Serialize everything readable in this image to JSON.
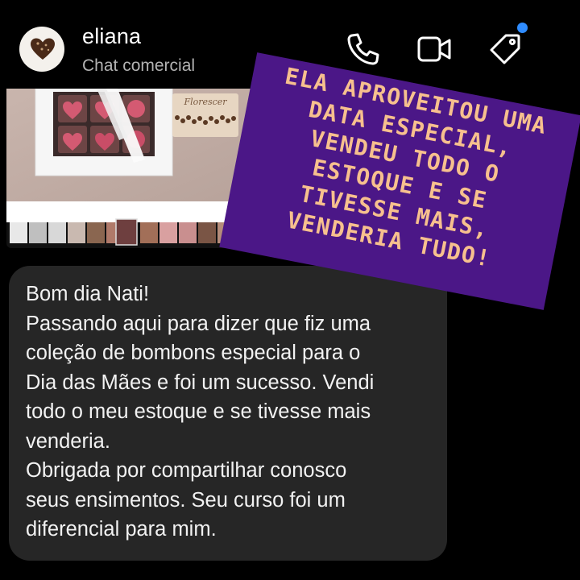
{
  "header": {
    "contact_name": "eliana",
    "contact_subtitle": "Chat comercial",
    "icons": [
      "phone-icon",
      "video-icon",
      "tag-icon"
    ],
    "notification_dot_color": "#2f8cff"
  },
  "shared_photo": {
    "card_text": "Florescer"
  },
  "message": {
    "lines": [
      "Bom dia Nati!",
      "Passando aqui para dizer que fiz uma",
      "coleção de bombons especial para o",
      "Dia das Mães e foi um sucesso. Vendi",
      "todo o meu estoque e se tivesse mais",
      "venderia.",
      "Obrigada por compartilhar conosco",
      "seus ensimentos. Seu curso foi um",
      "diferencial para mim."
    ]
  },
  "overlay": {
    "background_color": "#4b1787",
    "text_color": "#f7c08e",
    "lines": [
      "ELA APROVEITOU UMA",
      "DATA ESPECIAL,",
      "VENDEU TODO O",
      "ESTOQUE E SE",
      "TIVESSE MAIS,",
      "VENDERIA TUDO!"
    ]
  }
}
